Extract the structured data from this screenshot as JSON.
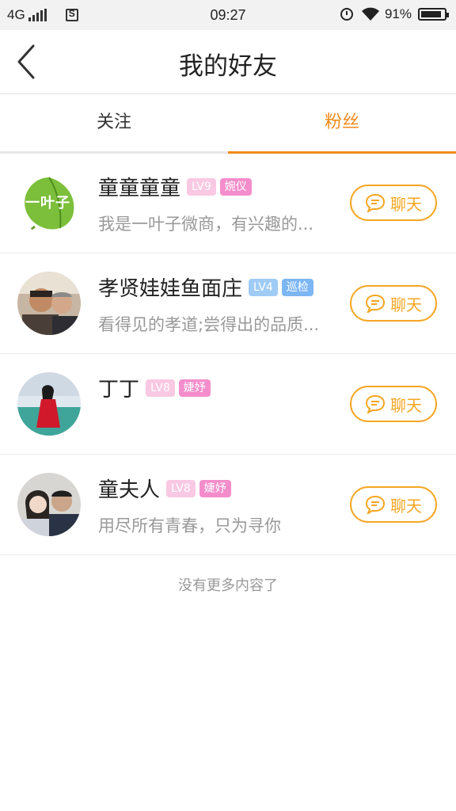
{
  "status_bar": {
    "network": "4G",
    "time": "09:27",
    "battery": "91%"
  },
  "header": {
    "title": "我的好友"
  },
  "tabs": [
    {
      "label": "关注",
      "active": false
    },
    {
      "label": "粉丝",
      "active": true
    }
  ],
  "fans": [
    {
      "name": "童童童童",
      "level": "LV9",
      "title": "婉仪",
      "signature": "我是一叶子微商，有兴趣的...",
      "chat_label": "聊天",
      "avatar_text": "一叶子"
    },
    {
      "name": "孝贤娃娃鱼面庄",
      "level": "LV4",
      "title": "巡检",
      "signature": "看得见的孝道;尝得出的品质...",
      "chat_label": "聊天"
    },
    {
      "name": "丁丁",
      "level": "LV8",
      "title": "婕妤",
      "signature": "",
      "chat_label": "聊天"
    },
    {
      "name": "童夫人",
      "level": "LV8",
      "title": "婕妤",
      "signature": "用尽所有青春，只为寻你",
      "chat_label": "聊天"
    }
  ],
  "footer": {
    "no_more": "没有更多内容了"
  },
  "colors": {
    "accent": "#f28a1b",
    "chat_button": "#f5a623",
    "badge_pink": "#f48dcb",
    "badge_blue": "#7cb6f3"
  }
}
